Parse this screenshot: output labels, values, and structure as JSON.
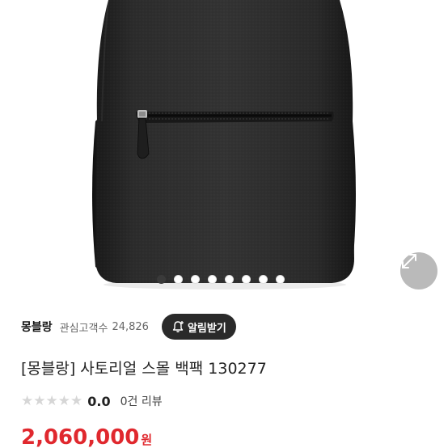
{
  "gallery": {
    "dots_total": 8,
    "active_index": 0,
    "expand_icon": "expand-arrows-icon"
  },
  "product": {
    "brand": "몽블랑",
    "interest_label": "관심고객수",
    "interest_count": "24,826",
    "notify_label": "알림받기",
    "notify_icon": "bell-plus-icon",
    "title": "[몽블랑] 사토리얼 스몰 백팩 130277",
    "rating": "0.0",
    "rating_stars": 0,
    "review_count": "0건 리뷰",
    "price": "2,060,000",
    "currency": "원"
  },
  "colors": {
    "price": "#e0282e",
    "notify_button": "#2a2a2a",
    "star_empty": "#d6d6d6"
  }
}
